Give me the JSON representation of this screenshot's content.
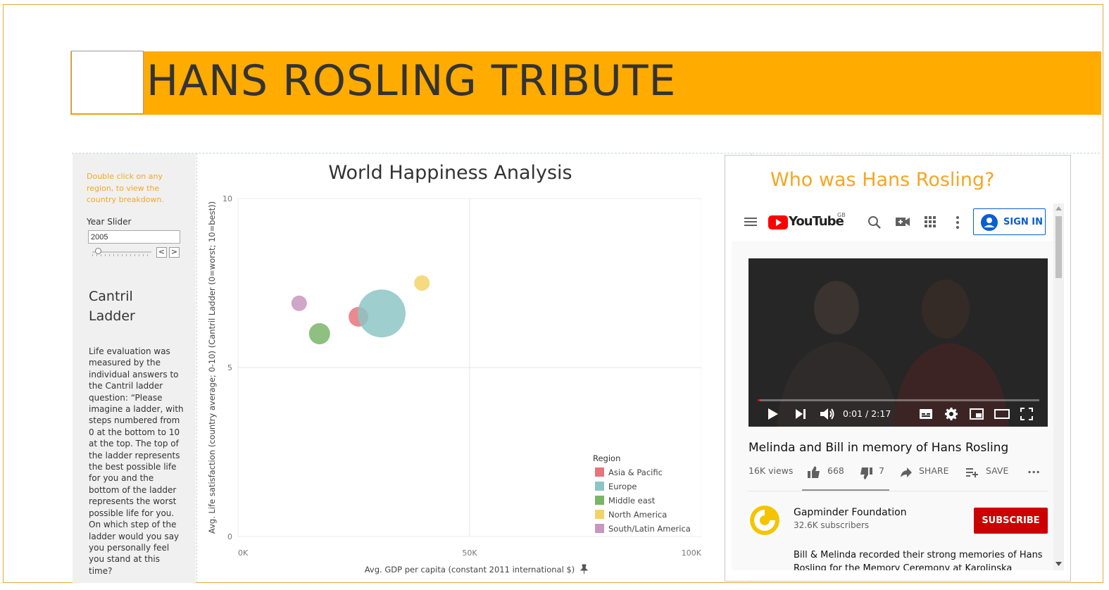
{
  "header": {
    "title": "HANS ROSLING TRIBUTE"
  },
  "sidebar": {
    "hint": "Double click on any region, to view the country breakdown.",
    "slider_label": "Year Slider",
    "year_value": "2005",
    "slider_fraction": 0.05,
    "prev_glyph": "<",
    "next_glyph": ">",
    "ladder_title": "Cantril Ladder",
    "ladder_text": "Life evaluation was measured by the individual answers to the Cantril ladder question: “Please imagine a ladder, with steps numbered from 0 at the bottom to 10 at the top. The top of the ladder represents the best possible life for you and the bottom of the ladder represents the worst possible life for you. On which step of the ladder would you say you personally feel you stand at this time?"
  },
  "chart_data": {
    "type": "scatter",
    "title": "World Happiness Analysis",
    "xlabel": "Avg. GDP per capita (constant 2011 international $)",
    "ylabel": "Avg. Life satisfaction (country average; 0-10) (Cantril Ladder (0=worst; 10=best))",
    "xlim": [
      0,
      100000
    ],
    "ylim": [
      0,
      10
    ],
    "x_ticks": [
      "0K",
      "50K",
      "100K"
    ],
    "y_ticks": [
      "10",
      "5",
      "0"
    ],
    "grid": true,
    "legend_title": "Region",
    "legend_position": "bottom-right",
    "series": [
      {
        "name": "Asia & Pacific",
        "color": "#e7747a",
        "x": 26000,
        "y": 6.5,
        "size": 14
      },
      {
        "name": "Europe",
        "color": "#8dc5c4",
        "x": 31000,
        "y": 6.6,
        "size": 34
      },
      {
        "name": "Middle east",
        "color": "#7ab56a",
        "x": 17600,
        "y": 6.0,
        "size": 15
      },
      {
        "name": "North America",
        "color": "#f2d36a",
        "x": 39700,
        "y": 7.5,
        "size": 11
      },
      {
        "name": "South/Latin America",
        "color": "#c896c0",
        "x": 13200,
        "y": 6.9,
        "size": 11
      }
    ]
  },
  "right": {
    "heading": "Who was Hans Rosling?",
    "youtube": {
      "logo_text": "YouTube",
      "region": "GB",
      "sign_in": "SIGN IN",
      "time": "0:01 / 2:17",
      "progress": 0.007,
      "video_title": "Melinda and Bill in memory of Hans Rosling",
      "views": "16K views",
      "likes": "668",
      "dislikes": "7",
      "share": "SHARE",
      "save": "SAVE",
      "more": "...",
      "channel": "Gapminder Foundation",
      "subscribers": "32.6K subscribers",
      "subscribe": "SUBSCRIBE",
      "description": "Bill & Melinda recorded their strong memories of Hans Rosling for the Memory Ceremony at Karolinska Institute"
    }
  },
  "colors": {
    "accent": "#ffab00",
    "orange_text": "#f5a623",
    "youtube_red": "#cc0000",
    "link_blue": "#065fd4"
  }
}
